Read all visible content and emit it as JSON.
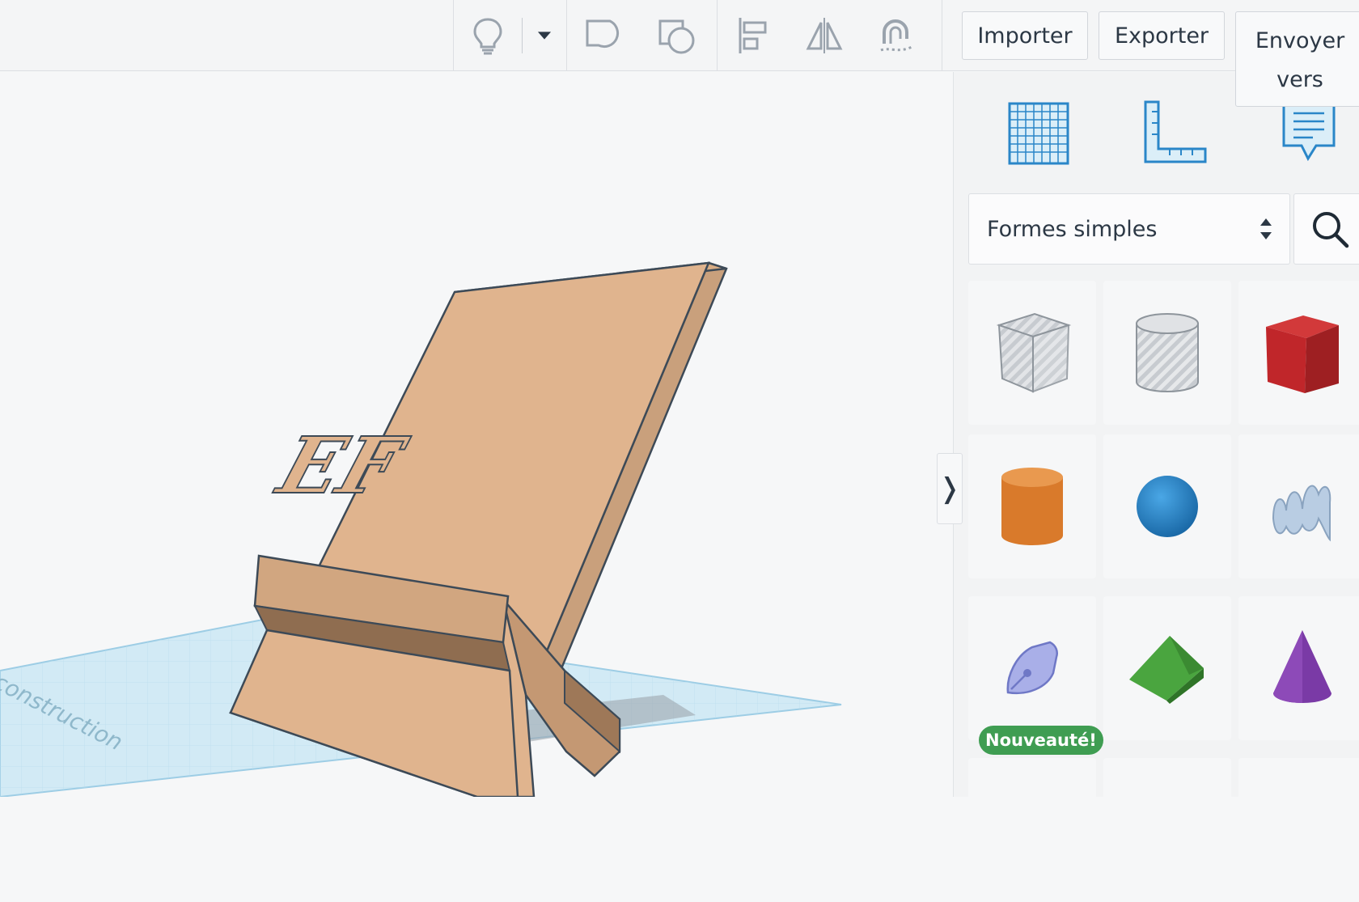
{
  "toolbar": {
    "import_label": "Importer",
    "export_label": "Exporter",
    "send_label_line1": "Envoyer",
    "send_label_line2": "vers",
    "tools": [
      "lightbulb-icon",
      "dropdown-chevron-icon",
      "group-icon",
      "ungroup-icon",
      "align-icon",
      "mirror-icon",
      "magnet-icon"
    ]
  },
  "panel": {
    "view_icons": [
      "grid-icon",
      "ruler-icon",
      "notes-icon"
    ],
    "category_select": {
      "value": "Formes simples"
    },
    "search_icon": "search-icon",
    "collapse_glyph": "❭",
    "shapes": [
      {
        "name": "box-hole",
        "color": "#b7bcc2"
      },
      {
        "name": "cylinder-hole",
        "color": "#c2c6cb"
      },
      {
        "name": "box",
        "color": "#c0262a"
      },
      {
        "name": "cylinder",
        "color": "#d97a2b"
      },
      {
        "name": "sphere",
        "color": "#2c8ad1"
      },
      {
        "name": "scribble",
        "color": "#aec4dc"
      },
      {
        "name": "sketch-pen",
        "color": "#9fa6e3",
        "badge": "Nouveauté!"
      },
      {
        "name": "roof",
        "color": "#4aa53f"
      },
      {
        "name": "cone",
        "color": "#7a3aa6"
      }
    ]
  },
  "viewport": {
    "embossed_text": "EF",
    "workplane_text": "construction"
  },
  "colors": {
    "object": "#e0b48e",
    "workplane": "#cfe8f3",
    "accent_blue": "#2a86c8"
  }
}
